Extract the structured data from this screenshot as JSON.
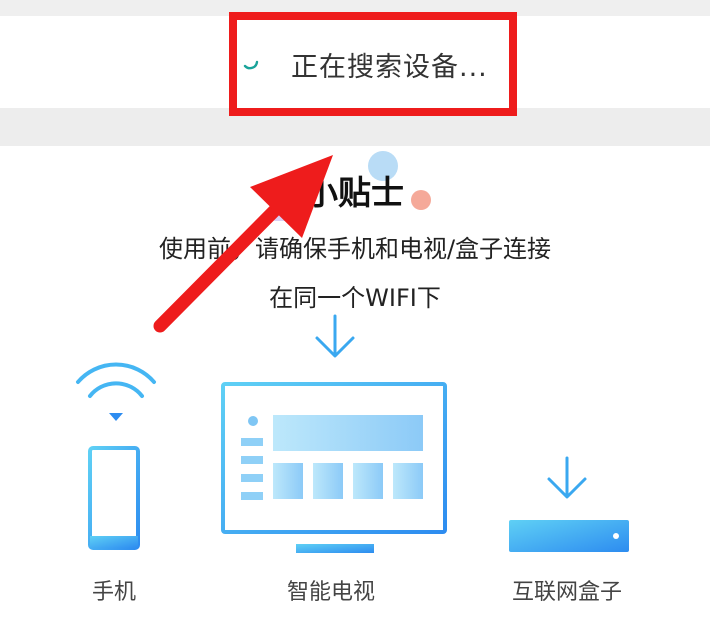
{
  "search": {
    "status_text": "正在搜索设备..."
  },
  "tips": {
    "title": "小贴士",
    "line1": "使用前，请确保手机和电视/盒子连接",
    "line2": "在同一个WIFI下"
  },
  "devices": [
    {
      "label": "手机",
      "icon": "phone-wifi-icon"
    },
    {
      "label": "智能电视",
      "icon": "smart-tv-icon"
    },
    {
      "label": "互联网盒子",
      "icon": "set-top-box-icon"
    }
  ],
  "colors": {
    "highlight": "#ee1c1c",
    "accent_blue": "#3aa8f0"
  }
}
